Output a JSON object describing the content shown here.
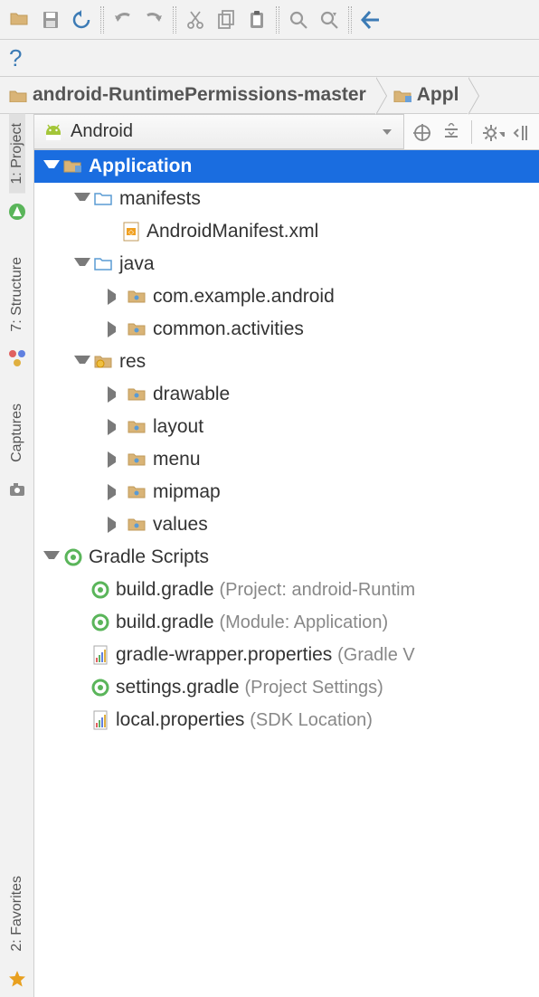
{
  "toolbar": {
    "help_symbol": "?"
  },
  "breadcrumb": {
    "item1": "android-RuntimePermissions-master",
    "item2": "Appl"
  },
  "sidebar": {
    "project": "1: Project",
    "structure": "7: Structure",
    "captures": "Captures",
    "favorites": "2: Favorites"
  },
  "panel": {
    "view_name": "Android"
  },
  "tree": {
    "application": {
      "label": "Application"
    },
    "manifests": {
      "label": "manifests"
    },
    "manifest_file": {
      "label": "AndroidManifest.xml"
    },
    "java": {
      "label": "java"
    },
    "pkg1": {
      "label": "com.example.android"
    },
    "pkg2": {
      "label": "common.activities"
    },
    "res": {
      "label": "res"
    },
    "res_drawable": {
      "label": "drawable"
    },
    "res_layout": {
      "label": "layout"
    },
    "res_menu": {
      "label": "menu"
    },
    "res_mipmap": {
      "label": "mipmap"
    },
    "res_values": {
      "label": "values"
    },
    "gradle_scripts": {
      "label": "Gradle Scripts"
    },
    "g1": {
      "name": "build.gradle",
      "hint": "(Project: android-Runtim"
    },
    "g2": {
      "name": "build.gradle",
      "hint": "(Module: Application)"
    },
    "g3": {
      "name": "gradle-wrapper.properties",
      "hint": "(Gradle V"
    },
    "g4": {
      "name": "settings.gradle",
      "hint": "(Project Settings)"
    },
    "g5": {
      "name": "local.properties",
      "hint": "(SDK Location)"
    }
  }
}
